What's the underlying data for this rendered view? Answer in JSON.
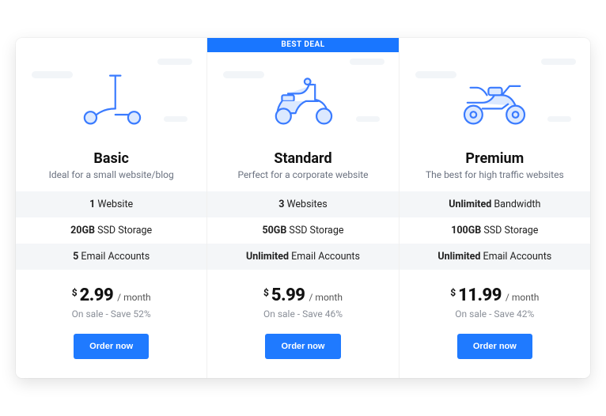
{
  "badge_label": "BEST DEAL",
  "currency": "$",
  "period": "/ month",
  "cta_label": "Order now",
  "plans": [
    {
      "name": "Basic",
      "subtitle": "Ideal for a small website/blog",
      "features": [
        {
          "bold": "1",
          "rest": " Website"
        },
        {
          "bold": "20GB",
          "rest": " SSD Storage"
        },
        {
          "bold": "5",
          "rest": " Email Accounts"
        }
      ],
      "price": "2.99",
      "sale": "On sale - Save 52%",
      "highlight": false,
      "icon": "scooter"
    },
    {
      "name": "Standard",
      "subtitle": "Perfect for a corporate website",
      "features": [
        {
          "bold": "3",
          "rest": " Websites"
        },
        {
          "bold": "50GB",
          "rest": " SSD Storage"
        },
        {
          "bold": "Unlimited",
          "rest": " Email Accounts"
        }
      ],
      "price": "5.99",
      "sale": "On sale - Save 46%",
      "highlight": true,
      "icon": "moped"
    },
    {
      "name": "Premium",
      "subtitle": "The best for high traffic websites",
      "features": [
        {
          "bold": "Unlimited",
          "rest": " Bandwidth"
        },
        {
          "bold": "100GB",
          "rest": " SSD Storage"
        },
        {
          "bold": "Unlimited",
          "rest": " Email Accounts"
        }
      ],
      "price": "11.99",
      "sale": "On sale - Save 42%",
      "highlight": false,
      "icon": "motorcycle"
    }
  ]
}
